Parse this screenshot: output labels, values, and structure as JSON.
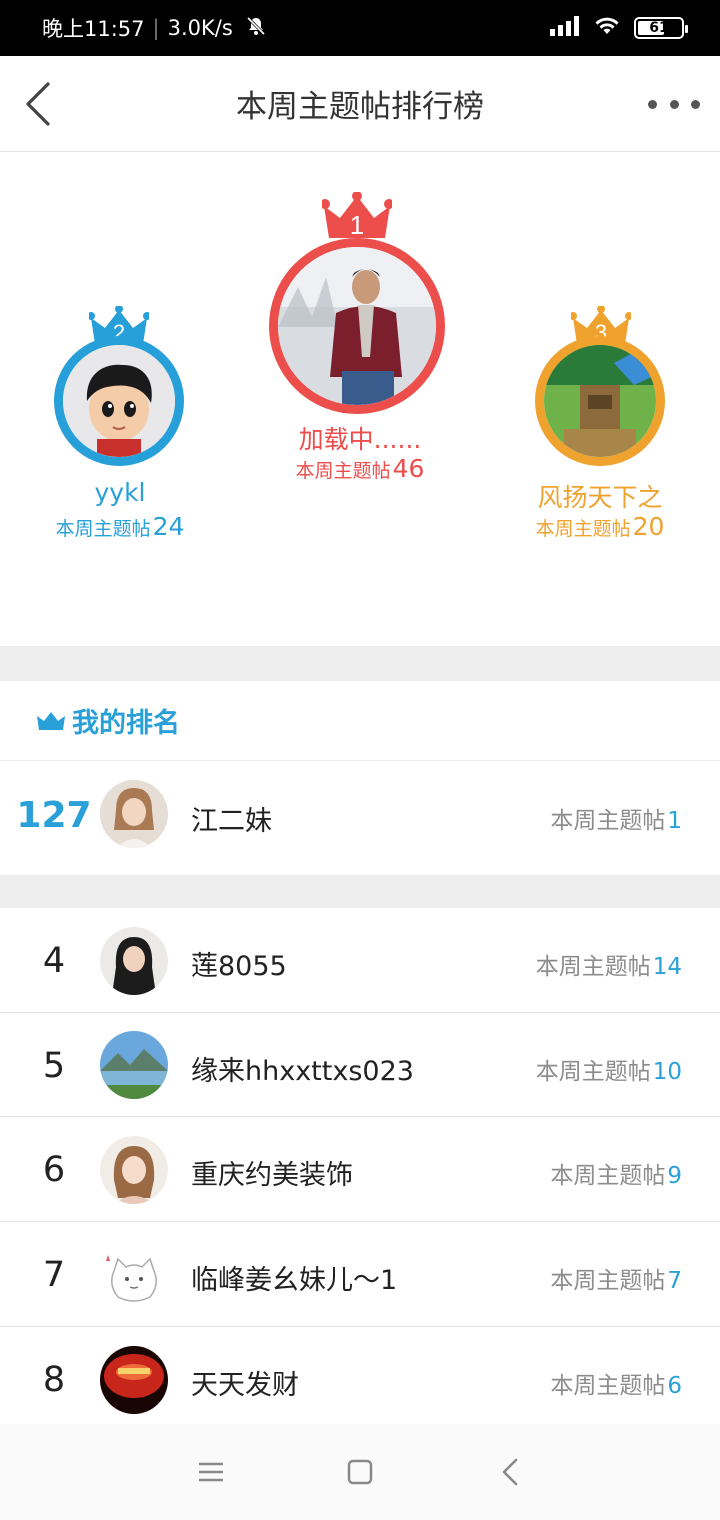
{
  "status_bar": {
    "time": "晚上11:57",
    "speed": "3.0K/s",
    "battery": "61",
    "battery_level": 0.61,
    "icons": [
      "mute-icon",
      "signal-icon",
      "wifi-icon",
      "battery-icon"
    ]
  },
  "nav": {
    "title": "本周主题帖排行榜",
    "icons": [
      "back-arrow-icon",
      "more-dots-icon"
    ]
  },
  "podium": [
    {
      "rank": "1",
      "name": "加载中......",
      "label": "本周主题帖",
      "count": "46",
      "color": "#ec4e4b"
    },
    {
      "rank": "2",
      "name": "yykl",
      "label": "本周主题帖",
      "count": "24",
      "color": "#27a0da"
    },
    {
      "rank": "3",
      "name": "风扬天下之",
      "label": "本周主题帖",
      "count": "20",
      "color": "#f0a22e"
    }
  ],
  "my_rank": {
    "title": "我的排名",
    "rank": "127",
    "name": "江二妹",
    "label": "本周主题帖",
    "count": "1",
    "accent": "#2aa0d8"
  },
  "list": [
    {
      "rank": "4",
      "name": "莲8055",
      "label": "本周主题帖",
      "count": "14"
    },
    {
      "rank": "5",
      "name": "缘来hhxxttxs023",
      "label": "本周主题帖",
      "count": "10"
    },
    {
      "rank": "6",
      "name": "重庆约美装饰",
      "label": "本周主题帖",
      "count": "9"
    },
    {
      "rank": "7",
      "name": "临峰姜幺妹儿～1",
      "label": "本周主题帖",
      "count": "7"
    },
    {
      "rank": "8",
      "name": "天天发财",
      "label": "本周主题帖",
      "count": "6"
    }
  ],
  "bottom_nav": {
    "icons": [
      "menu-icon",
      "home-square-icon",
      "back-triangle-icon"
    ]
  }
}
